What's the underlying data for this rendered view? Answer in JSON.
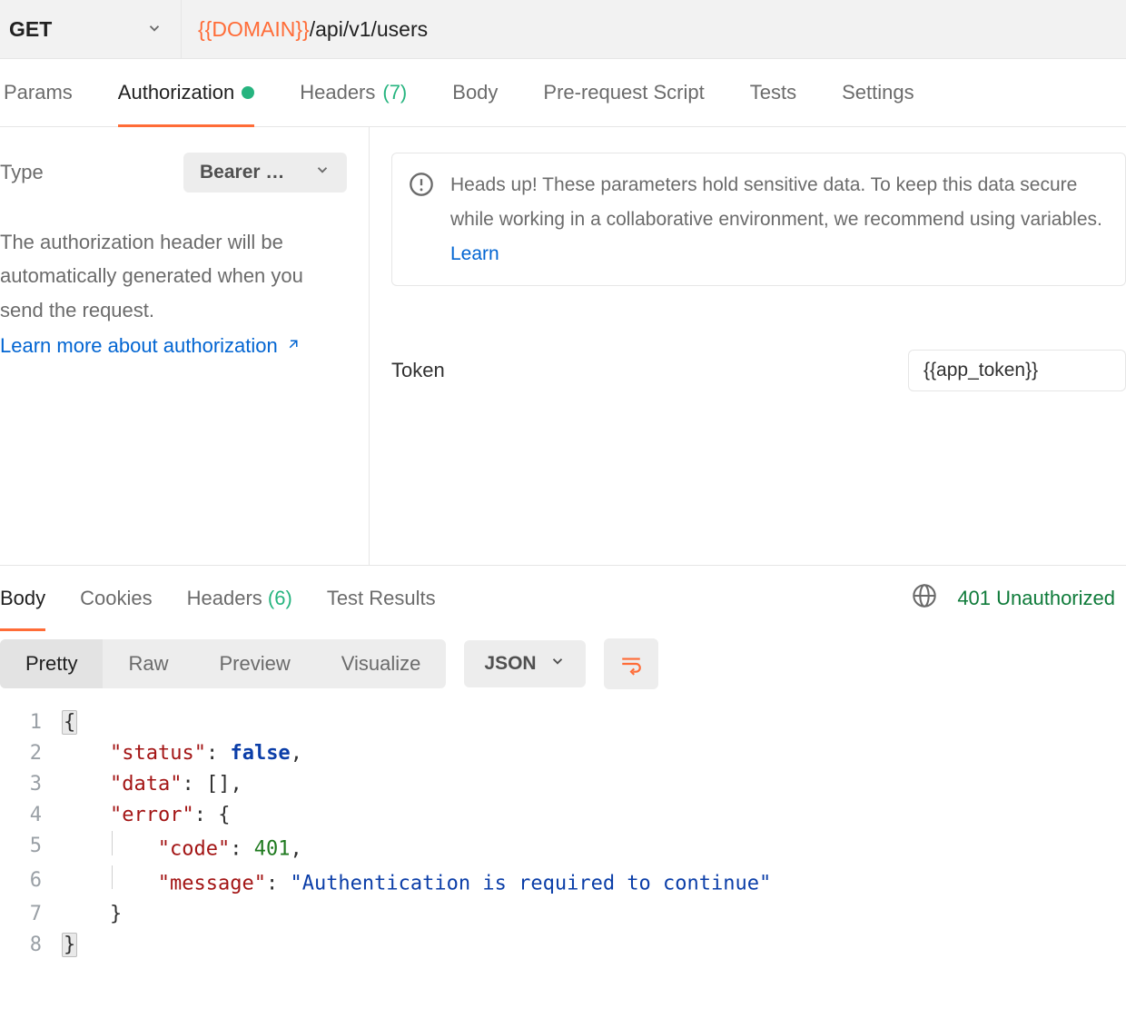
{
  "request": {
    "method": "GET",
    "url_variable": "{{DOMAIN}}",
    "url_path": "/api/v1/users"
  },
  "top_tabs": {
    "params": "Params",
    "authorization": "Authorization",
    "headers": "Headers",
    "headers_count": "(7)",
    "body": "Body",
    "pre_request": "Pre-request Script",
    "tests": "Tests",
    "settings": "Settings"
  },
  "auth_panel": {
    "type_label": "Type",
    "type_value": "Bearer …",
    "description": "The authorization header will be automatically generated when you send the request.",
    "learn_more": "Learn more about authorization",
    "banner_text": "Heads up! These parameters hold sensitive data. To keep this data secure while working in a collaborative environment, we recommend using variables.",
    "banner_learn": "Learn",
    "token_label": "Token",
    "token_value": "{{app_token}}"
  },
  "response_tabs": {
    "body": "Body",
    "cookies": "Cookies",
    "headers": "Headers",
    "headers_count": "(6)",
    "test_results": "Test Results",
    "status": "401 Unauthorized"
  },
  "view_bar": {
    "pretty": "Pretty",
    "raw": "Raw",
    "preview": "Preview",
    "visualize": "Visualize",
    "format": "JSON"
  },
  "response_body": {
    "line1": "{",
    "line2_key": "\"status\"",
    "line2_val": "false",
    "line3_key": "\"data\"",
    "line3_val": "[]",
    "line4_key": "\"error\"",
    "line4_val": "{",
    "line5_key": "\"code\"",
    "line5_val": "401",
    "line6_key": "\"message\"",
    "line6_val": "\"Authentication is required to continue\"",
    "line7": "}",
    "line8": "}",
    "ln1": "1",
    "ln2": "2",
    "ln3": "3",
    "ln4": "4",
    "ln5": "5",
    "ln6": "6",
    "ln7": "7",
    "ln8": "8"
  }
}
